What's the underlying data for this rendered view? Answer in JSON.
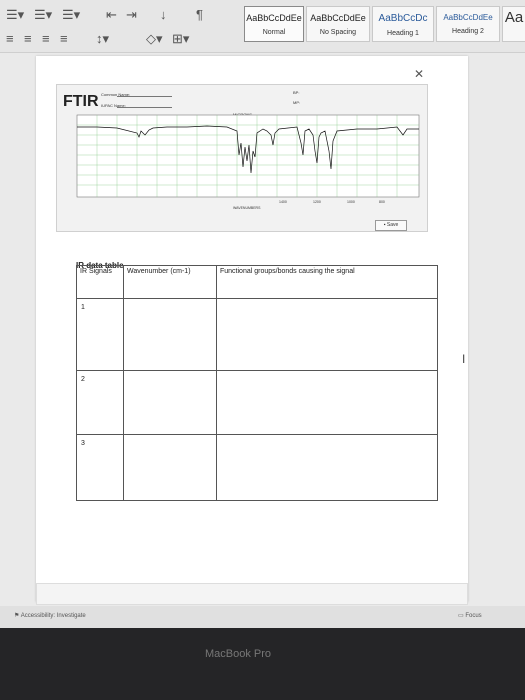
{
  "ribbon": {
    "styles": [
      {
        "preview": "AaBbCcDdEe",
        "name": "Normal"
      },
      {
        "preview": "AaBbCcDdEe",
        "name": "No Spacing"
      },
      {
        "preview": "AaBbCcDc",
        "name": "Heading 1"
      },
      {
        "preview": "AaBbCcDdEe",
        "name": "Heading 2"
      },
      {
        "preview": "Aa",
        "name": ""
      }
    ]
  },
  "ftir": {
    "title": "FTIR",
    "common_name": "Common Name:",
    "iupac_name": "IUPAC Name:",
    "bp": "BP:",
    "mp": "MP:",
    "microns": "MICRONS",
    "wavenumbers": "WAVENUMBERS",
    "save": "Save",
    "x_ticks": [
      "1400",
      "1200",
      "1000",
      "800"
    ]
  },
  "ir_table": {
    "title": "IR data table",
    "headers": [
      "IR Signals",
      "Wavenumber (cm-1)",
      "Functional groups/bonds causing the signal"
    ],
    "rows": [
      "1",
      "2",
      "3"
    ]
  },
  "status": {
    "accessibility": "Accessibility: Investigate",
    "focus": "Focus"
  },
  "device": {
    "label": "MacBook Pro"
  }
}
